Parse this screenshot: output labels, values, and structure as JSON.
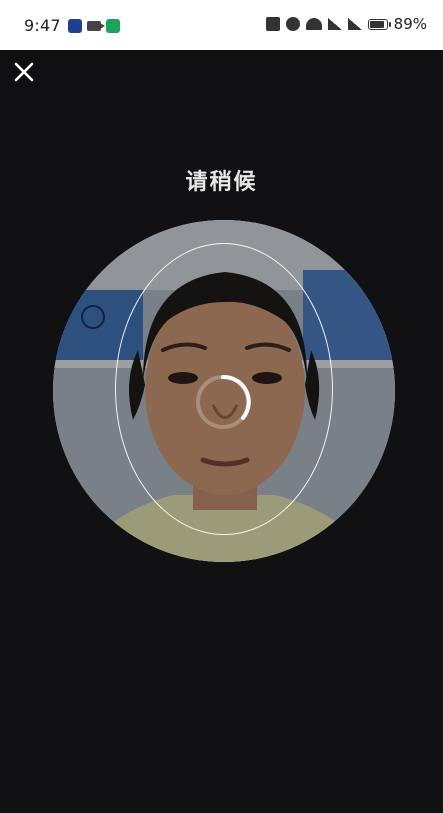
{
  "status_bar": {
    "time": "9:47",
    "battery": "89%",
    "icons": [
      "app-icon-blue",
      "video-camera-icon",
      "app-icon-green",
      "nfc-icon",
      "alarm-icon",
      "wifi-icon",
      "signal-5g-icon",
      "signal-5g-icon",
      "battery-icon"
    ]
  },
  "screen": {
    "title": "请稍候",
    "close_icon": "close-icon",
    "background_color": "#111113"
  }
}
